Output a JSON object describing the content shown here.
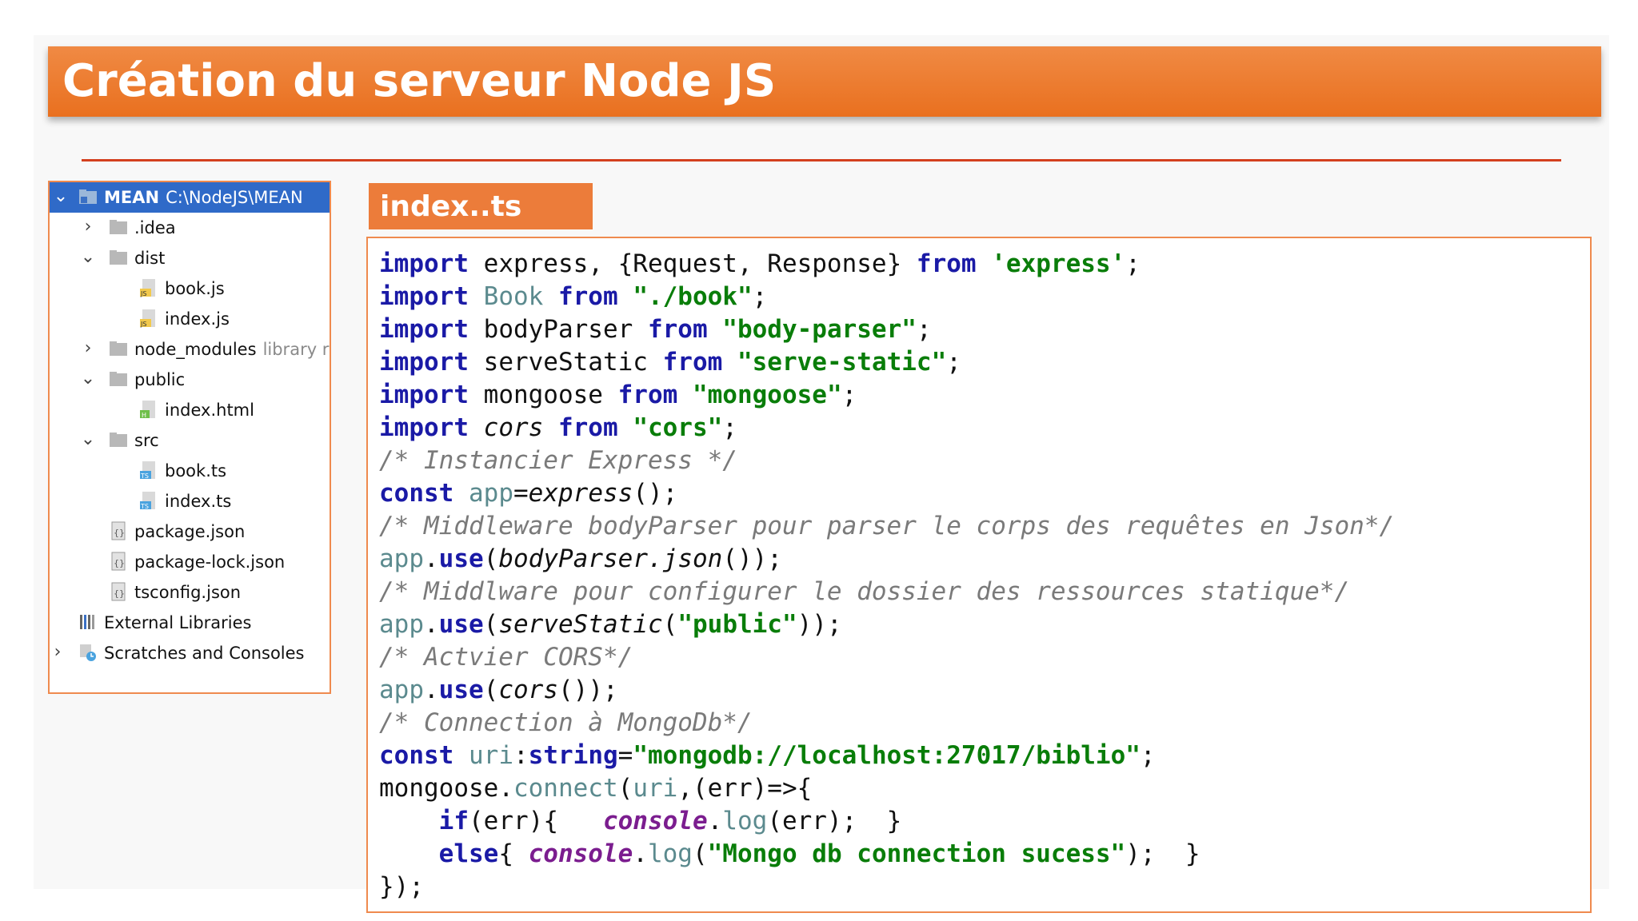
{
  "slide": {
    "title": "Création du serveur Node JS"
  },
  "project_tree": {
    "root": {
      "name": "MEAN",
      "path": "C:\\NodeJS\\MEAN"
    },
    "items": [
      {
        "label": ".idea"
      },
      {
        "label": "dist"
      },
      {
        "label": "book.js",
        "badge": "JS"
      },
      {
        "label": "index.js",
        "badge": "JS"
      },
      {
        "label": "node_modules",
        "hint": "library r"
      },
      {
        "label": "public"
      },
      {
        "label": "index.html",
        "badge": "H"
      },
      {
        "label": "src"
      },
      {
        "label": "book.ts",
        "badge": "TS"
      },
      {
        "label": "index.ts",
        "badge": "TS"
      },
      {
        "label": "package.json"
      },
      {
        "label": "package-lock.json"
      },
      {
        "label": "tsconfig.json"
      },
      {
        "label": "External Libraries"
      },
      {
        "label": "Scratches and Consoles"
      }
    ]
  },
  "editor": {
    "file_tab": "index..ts",
    "tokens": {
      "import": "import",
      "from": "from",
      "const": "const",
      "if": "if",
      "else": "else",
      "use": "use",
      "app": "app",
      "string": "string",
      "console": "console",
      "log": "log",
      "connect": "connect",
      "uri": "uri",
      "express": "express",
      "Book": "Book",
      "bodyParser": "bodyParser",
      "serveStatic": "serveStatic",
      "mongoose": "mongoose",
      "cors": "cors",
      "json": "json",
      "err": "err"
    },
    "strings": {
      "express": "'express'",
      "book": "\"./book\"",
      "body_parser": "\"body-parser\"",
      "serve_static": "\"serve-static\"",
      "mongoose": "\"mongoose\"",
      "cors": "\"cors\"",
      "public": "\"public\"",
      "mongo_uri": "\"mongodb://localhost:27017/biblio\"",
      "success": "\"Mongo db connection sucess\""
    },
    "comments": {
      "instancier": "/* Instancier Express */",
      "middleware_body": "/* Middleware bodyParser pour parser le corps des requêtes en Json*/",
      "middleware_static": "/* Middlware pour configurer le dossier des ressources statique*/",
      "cors": "/* Actvier CORS*/",
      "mongo": "/* Connection à MongoDb*/"
    }
  }
}
